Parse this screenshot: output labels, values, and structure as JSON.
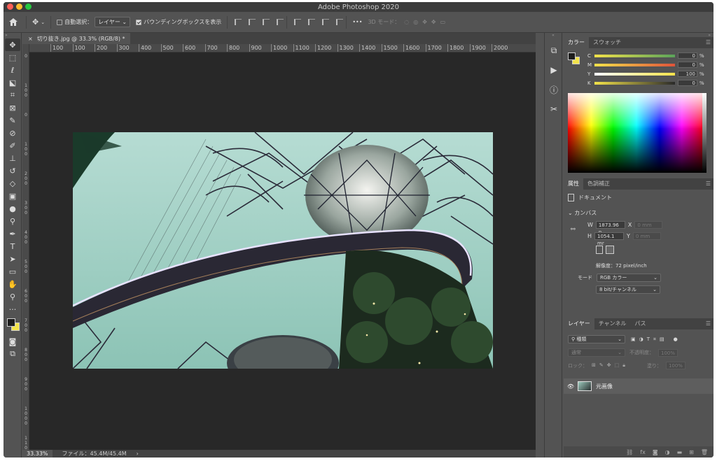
{
  "app": {
    "title": "Adobe Photoshop 2020"
  },
  "options_bar": {
    "auto_select_label": "自動選択：",
    "auto_select_value": "レイヤー",
    "bbox_label": "バウンディングボックスを表示",
    "more_label": "•••",
    "mode3d_label": "3D モード："
  },
  "document": {
    "tab_title": "切り抜き.jpg @ 33.3% (RGB/8) *",
    "close_glyph": "×"
  },
  "ruler": {
    "h_ticks": [
      "100",
      "100",
      "200",
      "300",
      "400",
      "500",
      "600",
      "700",
      "800",
      "900",
      "1000",
      "1100",
      "1200",
      "1300",
      "1400",
      "1500",
      "1600",
      "1700",
      "1800",
      "1900",
      "2000"
    ],
    "v_ticks": [
      "0",
      "100",
      "0",
      "100",
      "200",
      "300",
      "400",
      "500",
      "600",
      "700",
      "800",
      "900",
      "1000",
      "1100"
    ]
  },
  "status": {
    "zoom": "33.33%",
    "file": "ファイル：45.4M/45.4M",
    "arrow": "›"
  },
  "color_panel": {
    "tabs": [
      "カラー",
      "スウォッチ"
    ],
    "fg_color": "#1d1d1d",
    "bg_color": "#f2e34a",
    "sliders": [
      {
        "label": "C",
        "value": "0",
        "unit": "%",
        "gradient": "linear-gradient(to right,#f3e24a,#5aa35a)"
      },
      {
        "label": "M",
        "value": "0",
        "unit": "%",
        "gradient": "linear-gradient(to right,#f3e24a,#e0533a)"
      },
      {
        "label": "Y",
        "value": "100",
        "unit": "%",
        "gradient": "linear-gradient(to right,#ffffff,#f3e24a)"
      },
      {
        "label": "K",
        "value": "0",
        "unit": "%",
        "gradient": "linear-gradient(to right,#f3e24a,#2a2a2a)"
      }
    ]
  },
  "properties_panel": {
    "tabs": [
      "属性",
      "色調補正"
    ],
    "doc_label": "ドキュメント",
    "section": "カンバス",
    "w_label": "W",
    "w_value": "1873.96 n",
    "x_label": "X",
    "x_placeholder": "0 mm",
    "h_label": "H",
    "h_value": "1054.1 mr",
    "y_label": "Y",
    "y_placeholder": "0 mm",
    "resolution": "解像度：72 pixel/inch",
    "mode_label": "モード",
    "mode_value": "RGB カラー",
    "bits_value": "8 bit/チャンネル"
  },
  "layers_panel": {
    "tabs": [
      "レイヤー",
      "チャンネル",
      "パス"
    ],
    "filter_value": "種類",
    "blend_value": "通常",
    "opacity_label": "不透明度：",
    "opacity_value": "100%",
    "lock_label": "ロック：",
    "fill_label": "塗り：",
    "fill_value": "100%",
    "layer_name": "元画像",
    "bottom_icons": [
      "link-icon",
      "fx-icon",
      "mask-icon",
      "adjustment-icon",
      "folder-icon",
      "new-layer-icon",
      "trash-icon"
    ]
  }
}
